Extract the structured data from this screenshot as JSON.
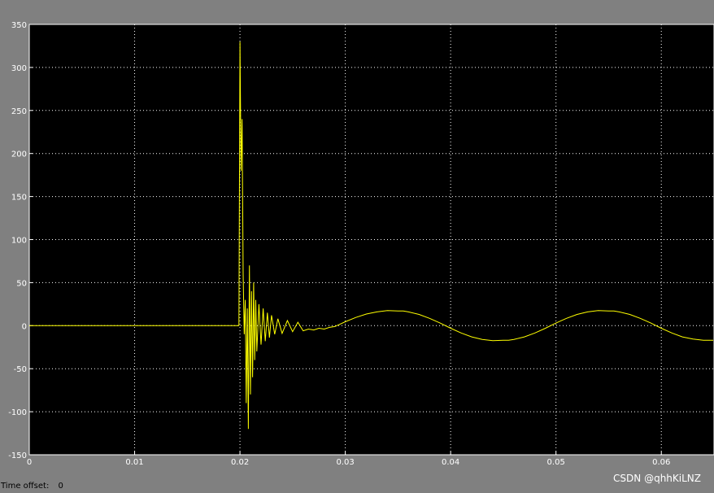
{
  "colors": {
    "window_bg": "#808080",
    "axes_bg": "#000000",
    "grid": "#ffffff",
    "signal": "#ffff00",
    "tick_text": "#ffffff"
  },
  "chart_data": {
    "type": "line",
    "title": "",
    "xlabel": "",
    "ylabel": "",
    "xlim": [
      0,
      0.065
    ],
    "ylim": [
      -150,
      350
    ],
    "xticks": [
      0,
      0.01,
      0.02,
      0.03,
      0.04,
      0.05,
      0.06
    ],
    "xtick_labels": [
      "0",
      "0.01",
      "0.02",
      "0.03",
      "0.04",
      "0.05",
      "0.06"
    ],
    "yticks": [
      -150,
      -100,
      -50,
      0,
      50,
      100,
      150,
      200,
      250,
      300,
      350
    ],
    "ytick_labels": [
      "-150",
      "-100",
      "-50",
      "0",
      "50",
      "100",
      "150",
      "200",
      "250",
      "300",
      "350"
    ],
    "grid": true,
    "grid_style": "dotted",
    "series": [
      {
        "color": "#ffff00",
        "x": [
          0,
          0.0199,
          0.02,
          0.0201,
          0.0202,
          0.0203,
          0.0204,
          0.0205,
          0.0206,
          0.0207,
          0.0208,
          0.0209,
          0.021,
          0.0211,
          0.0212,
          0.0213,
          0.0214,
          0.0215,
          0.0216,
          0.0218,
          0.022,
          0.0222,
          0.0224,
          0.0226,
          0.0228,
          0.023,
          0.0233,
          0.0236,
          0.024,
          0.0245,
          0.025,
          0.0255,
          0.026,
          0.0265,
          0.027,
          0.0275,
          0.028,
          0.0285,
          0.029,
          0.03,
          0.031,
          0.032,
          0.033,
          0.034,
          0.035,
          0.0355,
          0.036,
          0.037,
          0.038,
          0.039,
          0.04,
          0.041,
          0.042,
          0.043,
          0.044,
          0.045,
          0.0455,
          0.046,
          0.047,
          0.048,
          0.049,
          0.05,
          0.051,
          0.052,
          0.053,
          0.054,
          0.055,
          0.0555,
          0.056,
          0.057,
          0.058,
          0.059,
          0.06,
          0.061,
          0.062,
          0.063,
          0.064,
          0.065
        ],
        "y": [
          0,
          0,
          330,
          180,
          240,
          60,
          -10,
          30,
          -90,
          20,
          -120,
          70,
          -80,
          40,
          -60,
          50,
          -40,
          30,
          -30,
          25,
          -22,
          20,
          -18,
          15,
          -14,
          12,
          -10,
          8,
          -9,
          6,
          -7,
          4,
          -6,
          -4,
          -5,
          -3,
          -4,
          -2,
          -1,
          4.5,
          9.5,
          13.5,
          16,
          17.5,
          17,
          17,
          16,
          13,
          8.5,
          3,
          -3,
          -8.5,
          -13,
          -16,
          -17.5,
          -17,
          -17,
          -16,
          -13,
          -8.5,
          -3,
          3,
          8.5,
          13,
          16,
          17.5,
          17,
          17,
          16,
          13,
          8.5,
          3,
          -3,
          -8.5,
          -13,
          -15.5,
          -17,
          -17
        ]
      }
    ]
  },
  "footer": {
    "time_offset_label": "Time offset:",
    "time_offset_value": "0"
  },
  "watermark": "CSDN @qhhKiLNZ"
}
